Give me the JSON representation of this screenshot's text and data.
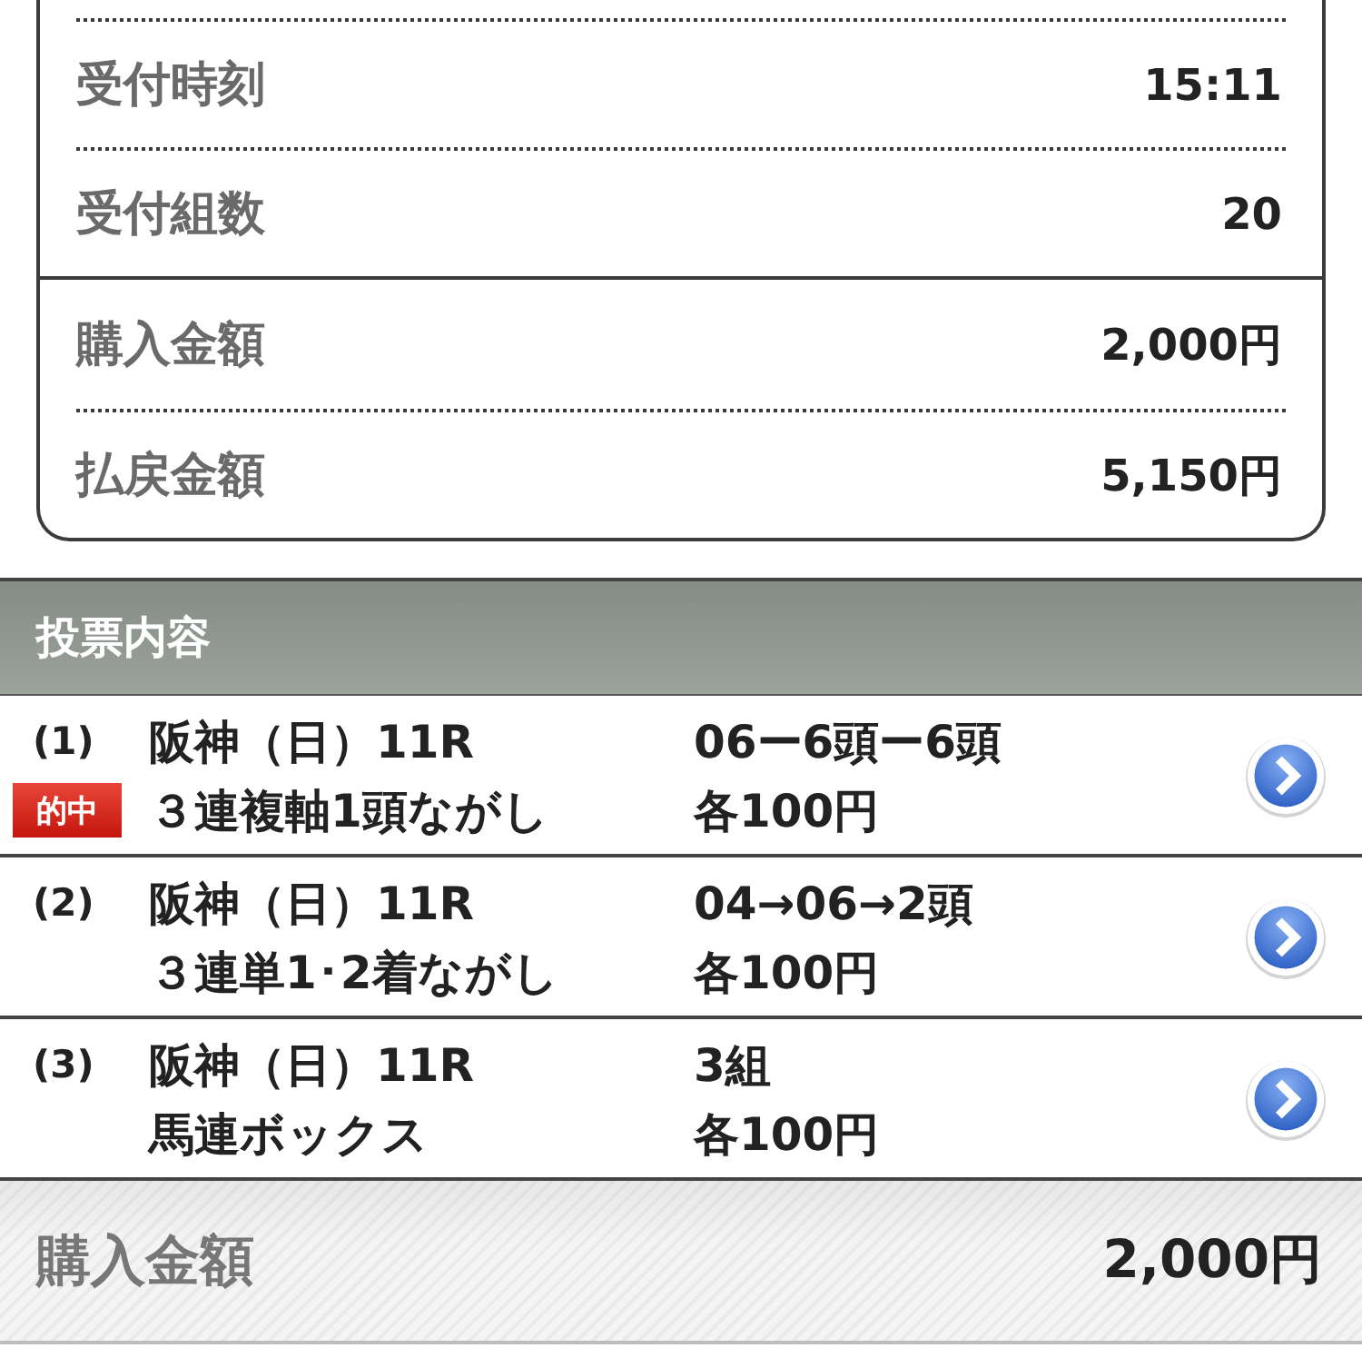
{
  "summary": {
    "groups": [
      {
        "rows": [
          {
            "label": "受付時刻",
            "value": "15:11"
          },
          {
            "label": "受付組数",
            "value": "20"
          }
        ]
      },
      {
        "rows": [
          {
            "label": "購入金額",
            "value": "2,000円"
          },
          {
            "label": "払戻金額",
            "value": "5,150円"
          }
        ]
      }
    ]
  },
  "section": {
    "title": "投票内容"
  },
  "bets": [
    {
      "number": "(1)",
      "race": "阪神（日）11R",
      "bet_type": "３連複軸1頭ながし",
      "combination": "06ー6頭ー6頭",
      "amount": "各100円",
      "hit": true,
      "hit_label": "的中"
    },
    {
      "number": "(2)",
      "race": "阪神（日）11R",
      "bet_type": "３連単1･2着ながし",
      "combination": "04→06→2頭",
      "amount": "各100円",
      "hit": false
    },
    {
      "number": "(3)",
      "race": "阪神（日）11R",
      "bet_type": "馬連ボックス",
      "combination": "3組",
      "amount": "各100円",
      "hit": false
    }
  ],
  "total": {
    "label": "購入金額",
    "value": "2,000円"
  }
}
